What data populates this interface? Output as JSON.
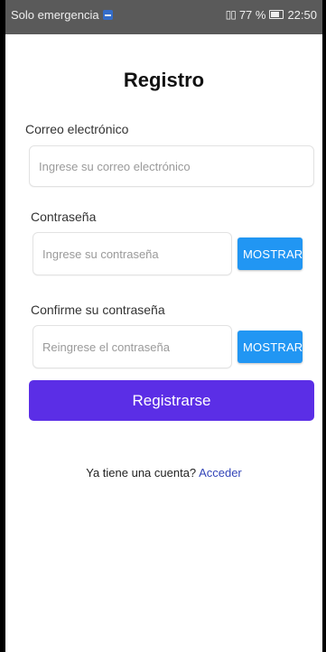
{
  "status_bar": {
    "carrier": "Solo emergencia",
    "battery_percent": "77 %",
    "time": "22:50"
  },
  "form": {
    "title": "Registro",
    "email": {
      "label": "Correo electrónico",
      "placeholder": "Ingrese su correo electrónico"
    },
    "password": {
      "label": "Contraseña",
      "placeholder": "Ingrese su contraseña",
      "toggle_label": "MOSTRAR"
    },
    "confirm_password": {
      "label": "Confirme su contraseña",
      "placeholder": "Reingrese el contraseña",
      "toggle_label": "MOSTRAR"
    },
    "submit_label": "Registrarse",
    "signin_prompt": "Ya tiene una cuenta?",
    "signin_link": "Acceder"
  },
  "colors": {
    "primary": "#5b2ee6",
    "toggle": "#2196f3",
    "link": "#3345b8",
    "status_bar": "#5a5a5a"
  }
}
